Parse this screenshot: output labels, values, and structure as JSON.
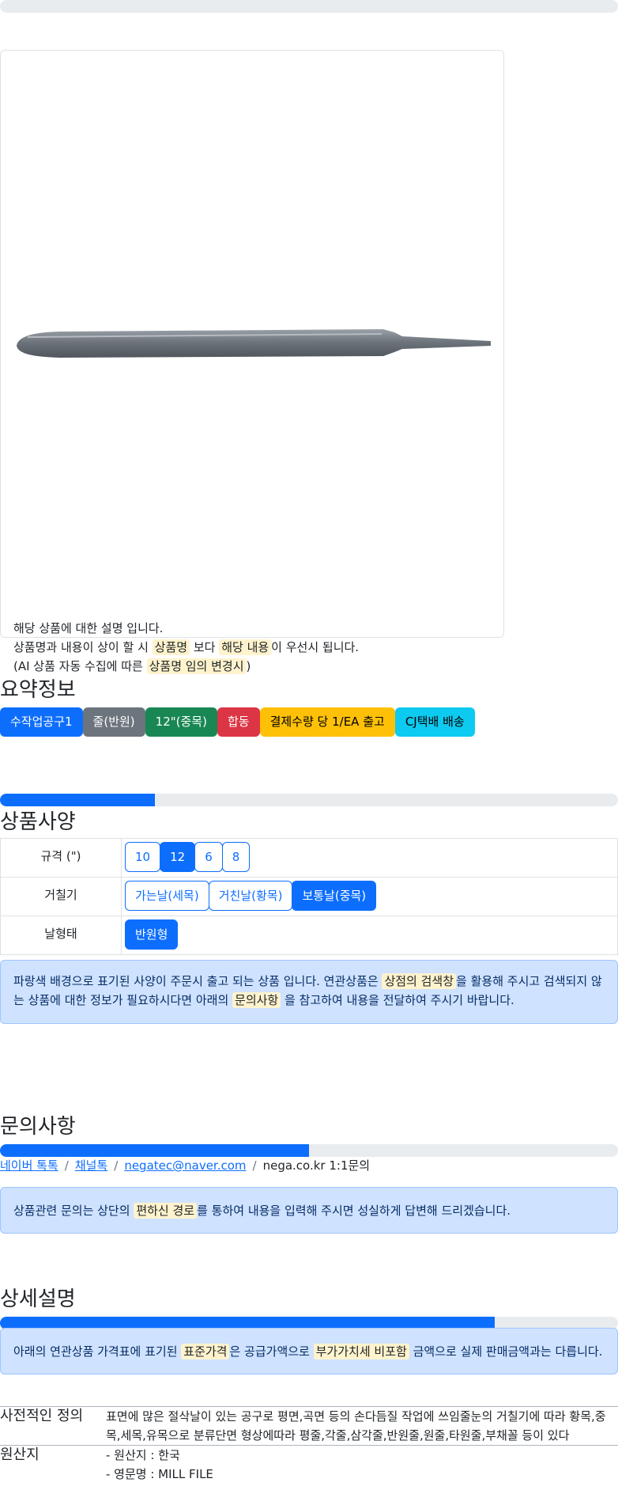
{
  "progress": {
    "top": 0,
    "spec": 0.25,
    "inquiry": 0.5,
    "detail": 0.8
  },
  "notice": {
    "line1": "해당 상품에 대한 설명 입니다.",
    "line2_a": "상품명과 내용이 상이 할 시 ",
    "line2_mark1": "상품명",
    "line2_b": " 보다 ",
    "line2_mark2": "해당 내용",
    "line2_c": "이 우선시 됩니다.",
    "line3_a": "(AI 상품 자동 수집에 따른 ",
    "line3_mark": "상품명 임의 변경시",
    "line3_b": ")"
  },
  "summary": {
    "title": "요약정보",
    "badges": [
      {
        "label": "수작업공구1",
        "color": "#0d6efd",
        "text": "#ffffff"
      },
      {
        "label": "줄(반원)",
        "color": "#6c757d",
        "text": "#ffffff"
      },
      {
        "label": "12\"(중목)",
        "color": "#198754",
        "text": "#ffffff"
      },
      {
        "label": "합동",
        "color": "#dc3545",
        "text": "#ffffff"
      },
      {
        "label": "결제수량 당 1/EA 출고",
        "color": "#ffc107",
        "text": "#000000"
      },
      {
        "label": "CJ택배 배송",
        "color": "#0dcaf0",
        "text": "#000000"
      }
    ]
  },
  "spec": {
    "title": "상품사양",
    "rows": [
      {
        "label": "규격 (\")",
        "options": [
          {
            "t": "10",
            "on": false
          },
          {
            "t": "12",
            "on": true
          },
          {
            "t": "6",
            "on": false
          },
          {
            "t": "8",
            "on": false
          }
        ]
      },
      {
        "label": "거칠기",
        "options": [
          {
            "t": "가는날(세목)",
            "on": false
          },
          {
            "t": "거친날(황목)",
            "on": false
          },
          {
            "t": "보통날(중목)",
            "on": true
          }
        ]
      },
      {
        "label": "날형태",
        "options": [
          {
            "t": "반원형",
            "on": true
          }
        ]
      }
    ],
    "alert_a": "파랑색 배경으로 표기된 사양이 주문시 출고 되는 상품 입니다. 연관상품은 ",
    "alert_mark1": "상점의 검색창",
    "alert_b": "을 활용해 주시고 검색되지 않는 상품에 대한 정보가 필요하시다면 아래의 ",
    "alert_mark2": "문의사항",
    "alert_c": " 을 참고하여 내용을 전달하여 주시기 바랍니다."
  },
  "inquiry": {
    "title": "문의사항",
    "links": [
      "네이버 톡톡",
      "채널톡",
      "negatec@naver.com"
    ],
    "plain": "nega.co.kr 1:1문의",
    "sep": "/",
    "alert_a": "상품관련 문의는 상단의 ",
    "alert_mark": "편하신 경로",
    "alert_b": "를 통하여 내용을 입력해 주시면 성실하게 답변해 드리겠습니다."
  },
  "detail": {
    "title": "상세설명",
    "alert_a": "아래의 연관상품 가격표에 표기된 ",
    "alert_mark1": "표준가격",
    "alert_b": "은 공급가액으로 ",
    "alert_mark2": "부가가치세 비포함",
    "alert_c": " 금액으로 실제 판매금액과는 다릅니다.",
    "rows": [
      {
        "head": "사전적인 정의",
        "body": [
          "표면에 많은 절삭날이 있는 공구로 평면,곡면 등의 손다듬질 작업에 쓰임줄눈의 거칠기에 따라 황목,중목,세목,유목으로 분류단면 형상에따라 평줄,각줄,삼각줄,반원줄,원줄,타원줄,부채꼴 등이 있다"
        ]
      },
      {
        "head": "원산지",
        "body": [
          "- 원산지 : 한국",
          "- 영문명 : MILL FILE"
        ]
      }
    ]
  }
}
